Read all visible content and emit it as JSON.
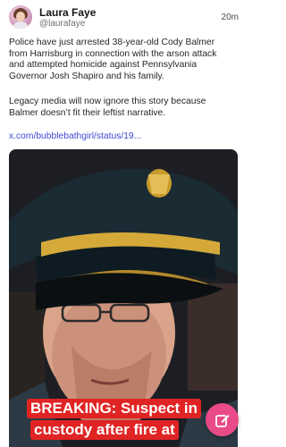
{
  "post": {
    "author_name": "Laura Faye",
    "author_handle": "@laurafaye",
    "timestamp": "20m",
    "text_lines": [
      "Police have just arrested 38-year-old Cody Balmer",
      "from Harrisburg in connection with the arson attack",
      "and attempted homicide against Pennsylvania",
      "Governor Josh Shapiro and his family."
    ],
    "text_lines_2": [
      "Legacy media will now ignore this story because",
      "Balmer doesn’t fit their leftist narrative."
    ],
    "link_text": "x.com/bubblebathgirl/status/19..."
  },
  "media": {
    "caption_line1": "BREAKING: Suspect in",
    "caption_line2": "custody after fire at"
  },
  "icons": {
    "avatar": "avatar-image",
    "compose": "pencil-square-icon"
  },
  "colors": {
    "link": "#3b49d6",
    "caption_bg": "#e02424",
    "fab": "#e84b87"
  }
}
